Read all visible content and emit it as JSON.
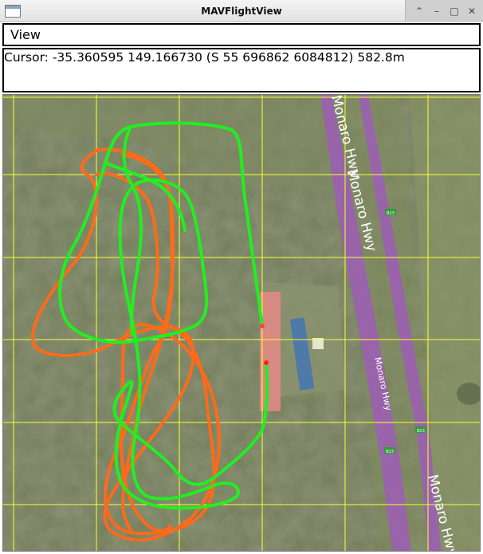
{
  "window": {
    "title": "MAVFlightView",
    "buttons": {
      "keep_above": "⌃",
      "minimize": "–",
      "maximize": "□",
      "close": "✕"
    }
  },
  "menu": {
    "items": [
      {
        "label": "View"
      }
    ]
  },
  "status": {
    "cursor_text": "Cursor: -35.360595 149.166730 (S 55 696862 6084812) 582.8m"
  },
  "map": {
    "labels": {
      "road_1": "Monaro Hwy",
      "road_2": "Monaro Hwy",
      "road_3": "Monaro Hwy",
      "road_4": "Monaro Hwy",
      "shield_1": "B23",
      "shield_2": "B23",
      "shield_3": "B23"
    },
    "colors": {
      "grid": "#ffff33",
      "track_green": "#22ee22",
      "track_orange": "#ff6a1a",
      "road": "#9b5fb0",
      "terrain": "#6f7a55"
    }
  }
}
